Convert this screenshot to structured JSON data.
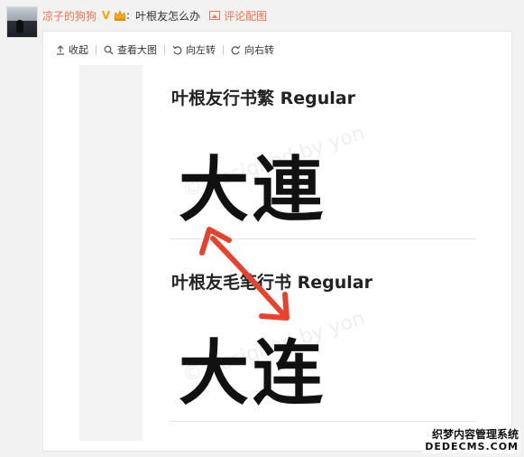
{
  "post": {
    "username": "凉子的狗狗",
    "vip_mark": "V",
    "colon": ":",
    "text": "叶根友怎么办",
    "comment_image_label": "评论配图"
  },
  "toolbar": {
    "collapse_label": "收起",
    "view_large_label": "查看大图",
    "rotate_left_label": "向左转",
    "rotate_right_label": "向右转"
  },
  "image": {
    "font1_title": "叶根友行书繁 Regular",
    "font1_sample": "大連",
    "font2_title": "叶根友毛笔行书 Regular",
    "font2_sample": "大连",
    "watermark_text": "© designed by yon"
  },
  "site_watermark": {
    "line1": "织梦内容管理系统",
    "line2": "DEDECMS.COM"
  },
  "colors": {
    "username": "#eb7350",
    "link": "#eb7350",
    "arrow": "#e8412c"
  }
}
